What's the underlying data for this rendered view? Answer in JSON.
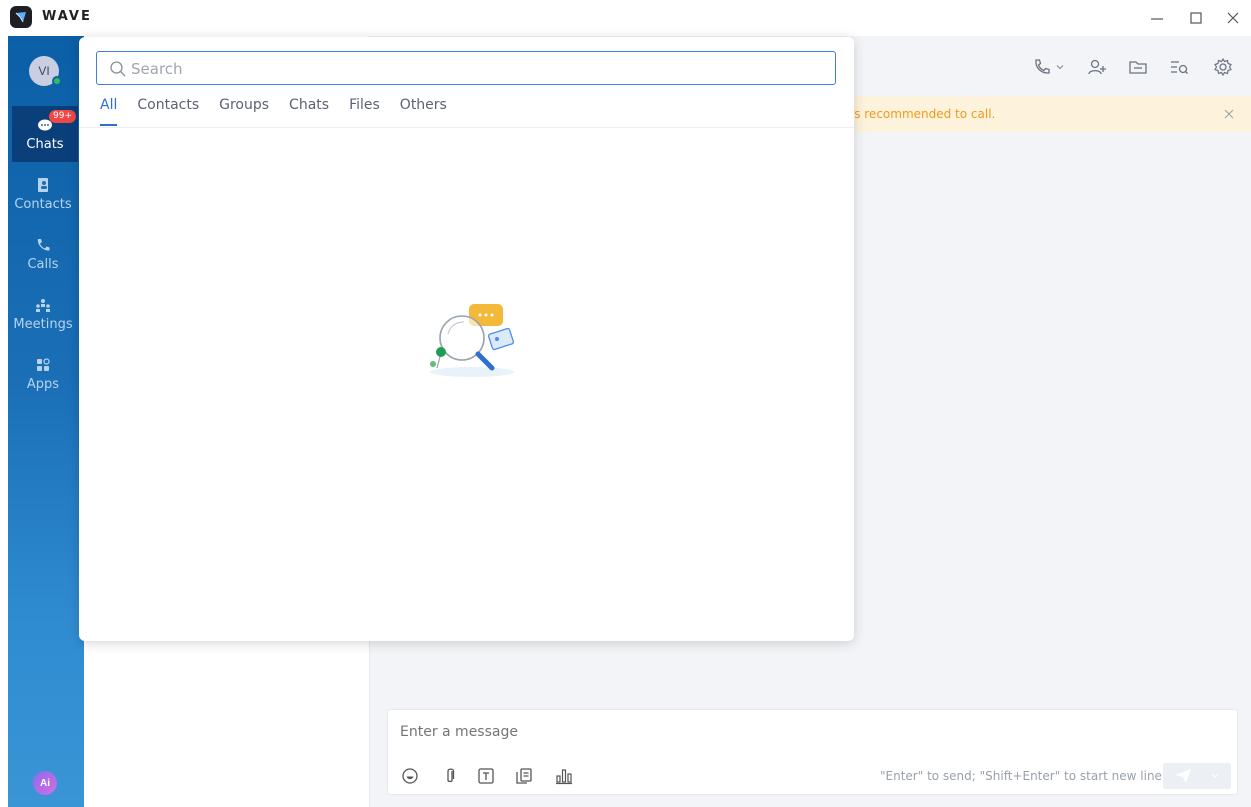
{
  "app": {
    "title": "WAVE"
  },
  "user": {
    "initials": "VI"
  },
  "sidebar": {
    "items": [
      {
        "id": "chats",
        "label": "Chats",
        "badge": "99+",
        "active": true
      },
      {
        "id": "contacts",
        "label": "Contacts"
      },
      {
        "id": "calls",
        "label": "Calls"
      },
      {
        "id": "meetings",
        "label": "Meetings"
      },
      {
        "id": "apps",
        "label": "Apps"
      }
    ],
    "ai_label": "Ai"
  },
  "search": {
    "placeholder": "Search",
    "value": "",
    "tabs": [
      "All",
      "Contacts",
      "Groups",
      "Chats",
      "Files",
      "Others"
    ],
    "active_tab": "All"
  },
  "notice": {
    "text": "e, it is recommended to call."
  },
  "composer": {
    "placeholder": "Enter a message",
    "hint": "\"Enter\" to send; \"Shift+Enter\" to start new line"
  },
  "colors": {
    "accent": "#2f6fd0",
    "sidebar_top": "#0b5fa6",
    "sidebar_bottom": "#3a95d6",
    "notice_bg": "#fdf2dc",
    "notice_text": "#f09a1a",
    "badge": "#f04747",
    "online": "#2fbf5a"
  },
  "icons": {
    "header": [
      "phone-icon",
      "chevron-down-icon",
      "add-user-icon",
      "folder-icon",
      "search-history-icon",
      "gear-icon"
    ],
    "composer_tools": [
      "emoji-icon",
      "attachment-icon",
      "text-format-icon",
      "template-icon",
      "poll-icon"
    ]
  }
}
